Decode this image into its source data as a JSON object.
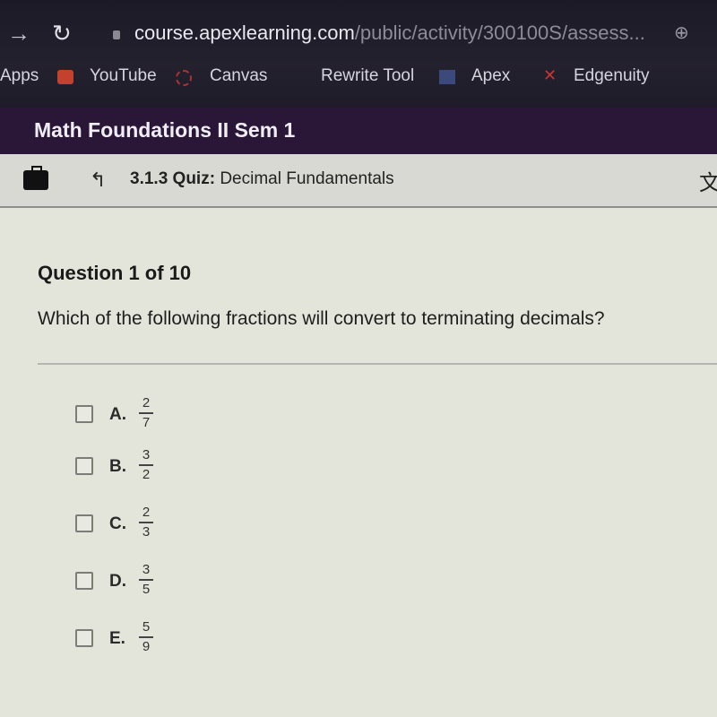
{
  "browser": {
    "url_host": "course.apexlearning.com",
    "url_path": "/public/activity/300100S/assess...",
    "bookmarks": [
      "Apps",
      "YouTube",
      "Canvas",
      "Rewrite Tool",
      "Apex",
      "Edgenuity"
    ]
  },
  "course": {
    "title": "Math Foundations II Sem 1"
  },
  "breadcrumb": {
    "number": "3.1.3",
    "type": "Quiz:",
    "name": "Decimal Fundamentals"
  },
  "question": {
    "counter": "Question 1 of 10",
    "prompt": "Which of the following fractions will convert to terminating decimals?",
    "options": [
      {
        "letter": "A.",
        "numerator": "2",
        "denominator": "7",
        "checked": false
      },
      {
        "letter": "B.",
        "numerator": "3",
        "denominator": "2",
        "checked": false
      },
      {
        "letter": "C.",
        "numerator": "2",
        "denominator": "3",
        "checked": false
      },
      {
        "letter": "D.",
        "numerator": "3",
        "denominator": "5",
        "checked": false
      },
      {
        "letter": "E.",
        "numerator": "5",
        "denominator": "9",
        "checked": false
      }
    ]
  }
}
